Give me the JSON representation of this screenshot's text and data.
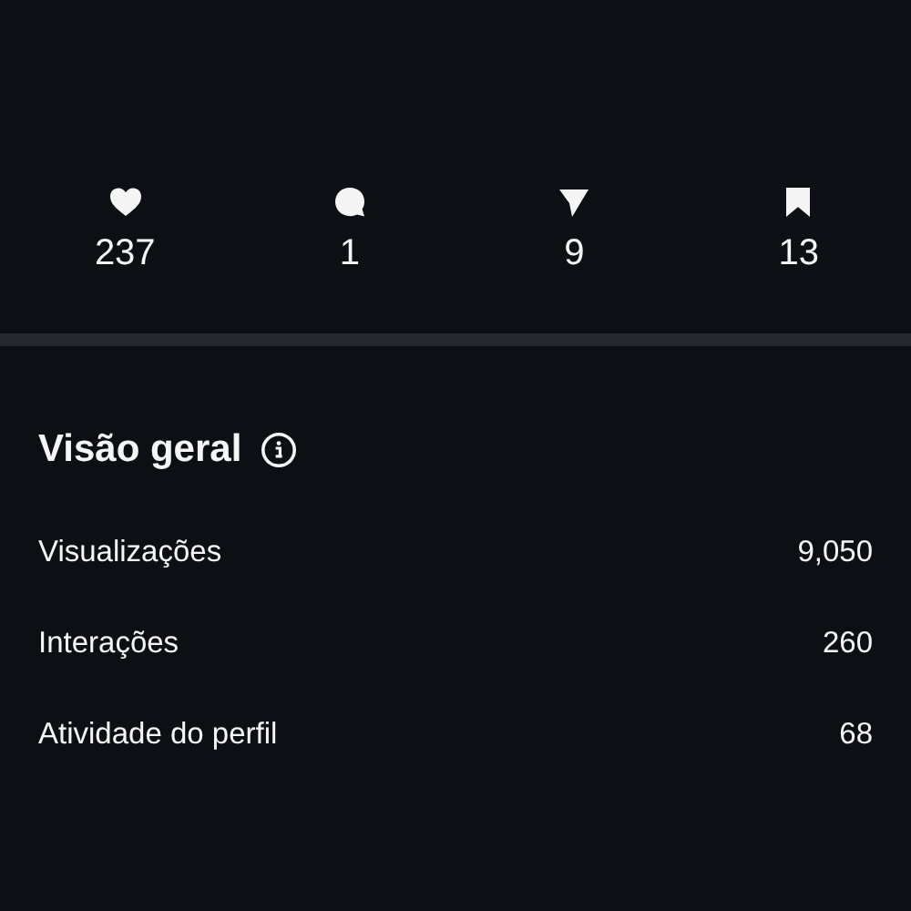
{
  "stats": [
    {
      "kind": "heart",
      "value": "237"
    },
    {
      "kind": "comment",
      "value": "1"
    },
    {
      "kind": "share",
      "value": "9"
    },
    {
      "kind": "save",
      "value": "13"
    }
  ],
  "overview": {
    "title": "Visão geral",
    "info_icon": true,
    "rows": [
      {
        "label": "Visualizações",
        "value": "9,050"
      },
      {
        "label": "Interações",
        "value": "260"
      },
      {
        "label": "Atividade do perfil",
        "value": "68"
      }
    ]
  }
}
